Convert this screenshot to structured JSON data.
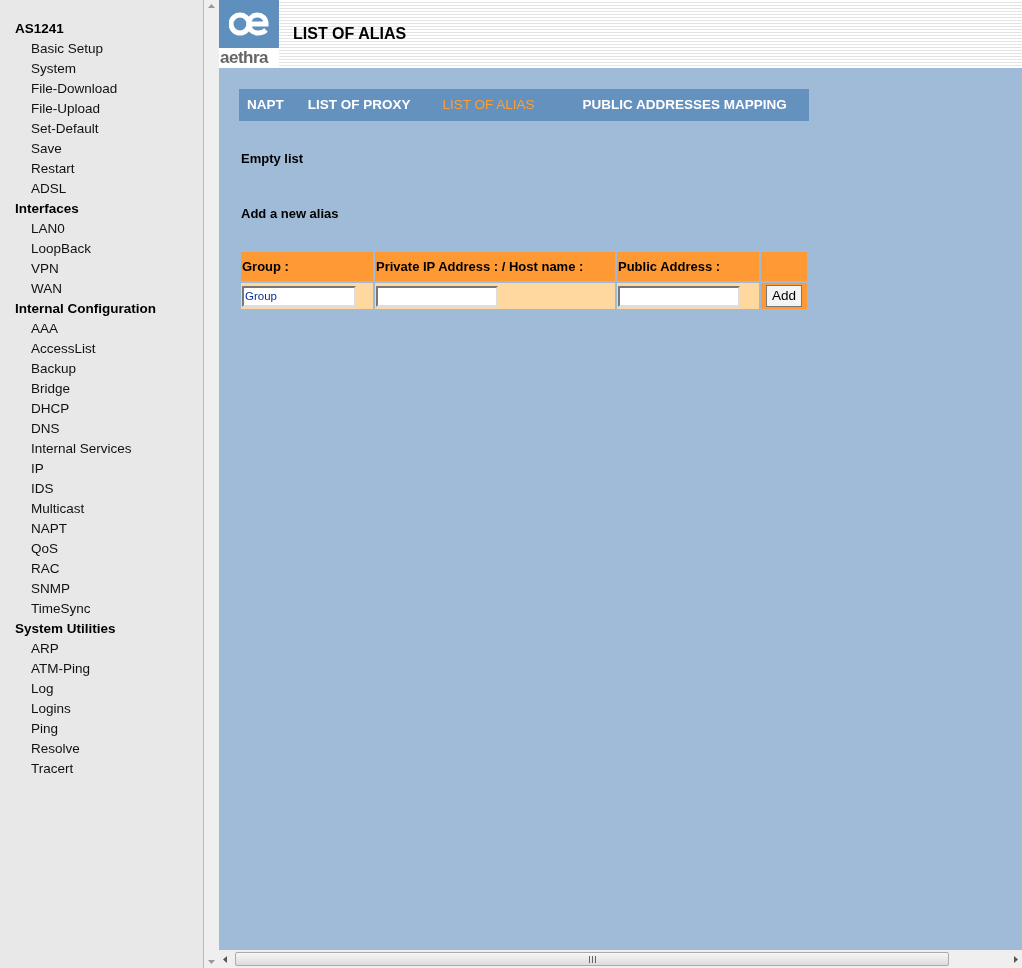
{
  "sidebar": {
    "groups": [
      {
        "label": "AS1241",
        "children": [
          {
            "label": "Basic Setup"
          },
          {
            "label": "System"
          },
          {
            "label": "File-Download"
          },
          {
            "label": "File-Upload"
          },
          {
            "label": "Set-Default"
          },
          {
            "label": "Save"
          },
          {
            "label": "Restart"
          },
          {
            "label": "ADSL"
          }
        ]
      },
      {
        "label": "Interfaces",
        "children": [
          {
            "label": "LAN0"
          },
          {
            "label": "LoopBack"
          },
          {
            "label": "VPN"
          },
          {
            "label": "WAN"
          }
        ]
      },
      {
        "label": "Internal Configuration",
        "children": [
          {
            "label": "AAA"
          },
          {
            "label": "AccessList"
          },
          {
            "label": "Backup"
          },
          {
            "label": "Bridge"
          },
          {
            "label": "DHCP"
          },
          {
            "label": "DNS"
          },
          {
            "label": "Internal Services"
          },
          {
            "label": "IP"
          },
          {
            "label": "IDS"
          },
          {
            "label": "Multicast"
          },
          {
            "label": "NAPT"
          },
          {
            "label": "QoS"
          },
          {
            "label": "RAC"
          },
          {
            "label": "SNMP"
          },
          {
            "label": "TimeSync"
          }
        ]
      },
      {
        "label": "System Utilities",
        "children": [
          {
            "label": "ARP"
          },
          {
            "label": "ATM-Ping"
          },
          {
            "label": "Log"
          },
          {
            "label": "Logins"
          },
          {
            "label": "Ping"
          },
          {
            "label": "Resolve"
          },
          {
            "label": "Tracert"
          }
        ]
      }
    ]
  },
  "header": {
    "logo_text": "aethra",
    "title": "LIST OF ALIAS"
  },
  "tabs": [
    {
      "label": "NAPT",
      "selected": false
    },
    {
      "label": "LIST OF PROXY",
      "selected": false
    },
    {
      "label": "LIST OF ALIAS",
      "selected": true
    },
    {
      "label": "PUBLIC ADDRESSES MAPPING",
      "selected": false
    }
  ],
  "list_status": "Empty list",
  "add_heading": "Add a new alias",
  "form": {
    "columns": [
      "Group :",
      "Private IP Address : / Host name :",
      "Public Address :"
    ],
    "group_value": "Group",
    "button": "Add"
  }
}
